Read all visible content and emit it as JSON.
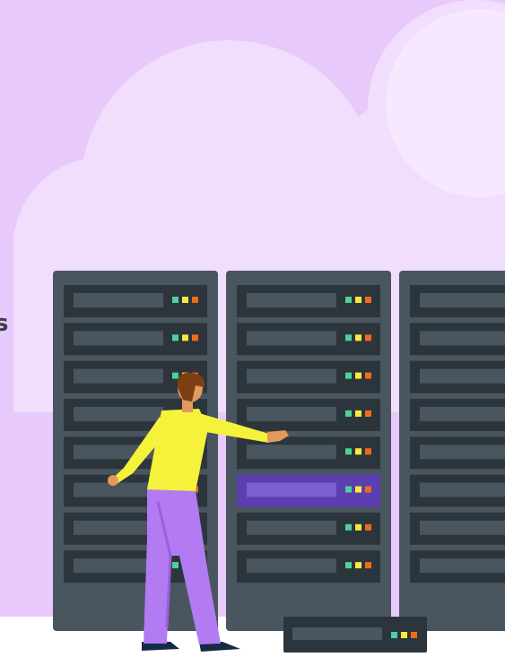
{
  "illustration": {
    "subject": "person-servicing-server-racks",
    "edge_text": "s",
    "colors": {
      "background_lavender": "#e8c9fc",
      "cloud": "#f1defd",
      "cloud_light": "#f7ecff",
      "floor": "#ffffff",
      "rack_body": "#4a565f",
      "rack_slot": "#2c353c",
      "rack_slot_highlight": "#5b3fb0",
      "led_green": "#4ed19c",
      "led_yellow": "#f4ec3a",
      "led_orange": "#f26a1b",
      "shirt": "#f5f23b",
      "pants": "#b27bf2",
      "hair": "#7c3f12",
      "skin": "#e39a5c",
      "shoes": "#152a44"
    },
    "racks": [
      {
        "name": "rack-left",
        "slots": 8,
        "highlighted_slot": null
      },
      {
        "name": "rack-middle",
        "slots": 8,
        "highlighted_slot": 5
      },
      {
        "name": "rack-right",
        "slots": 8,
        "highlighted_slot": null
      }
    ],
    "floor_unit": {
      "name": "floor-server-unit",
      "leds": [
        "green",
        "yellow",
        "orange"
      ]
    }
  }
}
